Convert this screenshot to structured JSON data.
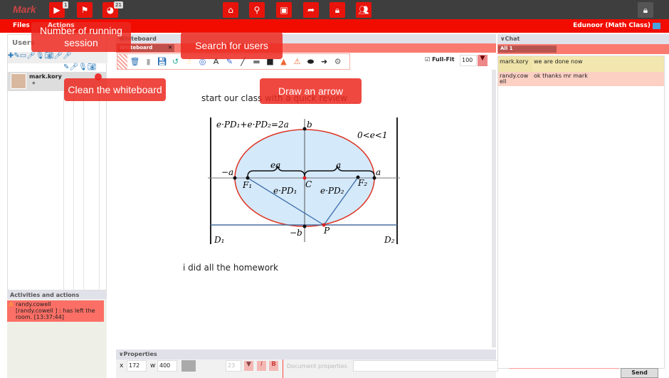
{
  "topbar": {
    "user": "Mark",
    "buttons": [
      {
        "icon": "play-icon",
        "badge": "1"
      },
      {
        "icon": "flag-icon"
      },
      {
        "icon": "globe-icon",
        "badge": "21"
      },
      {
        "icon": "home-icon"
      },
      {
        "icon": "search-icon"
      },
      {
        "icon": "contact-card-icon"
      },
      {
        "icon": "share-icon"
      },
      {
        "icon": "lock-icon"
      },
      {
        "icon": "users-icon"
      }
    ],
    "right_icon": "lock-icon"
  },
  "menu": {
    "files": "Files",
    "actions": "Actions",
    "room": "Edunoor (Math Class)"
  },
  "users": {
    "title": "Users",
    "user": {
      "name": "mark.kory",
      "status": "*"
    }
  },
  "activities": {
    "title": "Activities and actions",
    "item": {
      "user": "randy.cowell",
      "text": "[randy.cowell  ] : has left the room. [13:37:44]"
    }
  },
  "whiteboard": {
    "title": "Whiteboard",
    "tab": "Whiteboard",
    "fullfit": "Full-Fit",
    "zoom": "100",
    "texts": [
      "start our class with a quick review",
      "i did all the homework"
    ],
    "diagram": {
      "equation": "e·PD₁+e·PD₂=2a",
      "condition": "0<e<1",
      "labels": {
        "b": "b",
        "minus_b": "−b",
        "a": "a",
        "minus_a": "−a",
        "ea": "ea",
        "a_brace": "a",
        "F1": "F₁",
        "F2": "F₂",
        "C": "C",
        "P": "P",
        "ePD1": "e·PD₁",
        "ePD2": "e·PD₂",
        "D1": "D₁",
        "D2": "D₂"
      }
    }
  },
  "properties": {
    "title": "Properties",
    "x_label": "x",
    "x": "172",
    "w_label": "w",
    "w": "400",
    "font_size": "23",
    "italic": "I",
    "bold": "B",
    "doc_label": "Document properties"
  },
  "chat": {
    "title": "Chat",
    "tab": "All 1",
    "messages": [
      {
        "user": "mark.kory",
        "text": "we are done now",
        "color": "#efe4a8"
      },
      {
        "user": "randy.cowell",
        "text": "ok thanks mr mark",
        "color": "#fdd0c4"
      }
    ],
    "send": "Send"
  },
  "tooltips": {
    "sessions": "Number of running session",
    "search": "Search for users",
    "clean": "Clean the whiteboard",
    "arrow": "Draw an arrow"
  },
  "colors": {
    "accent": "#f20c00",
    "tooltip": "#eb281e"
  }
}
